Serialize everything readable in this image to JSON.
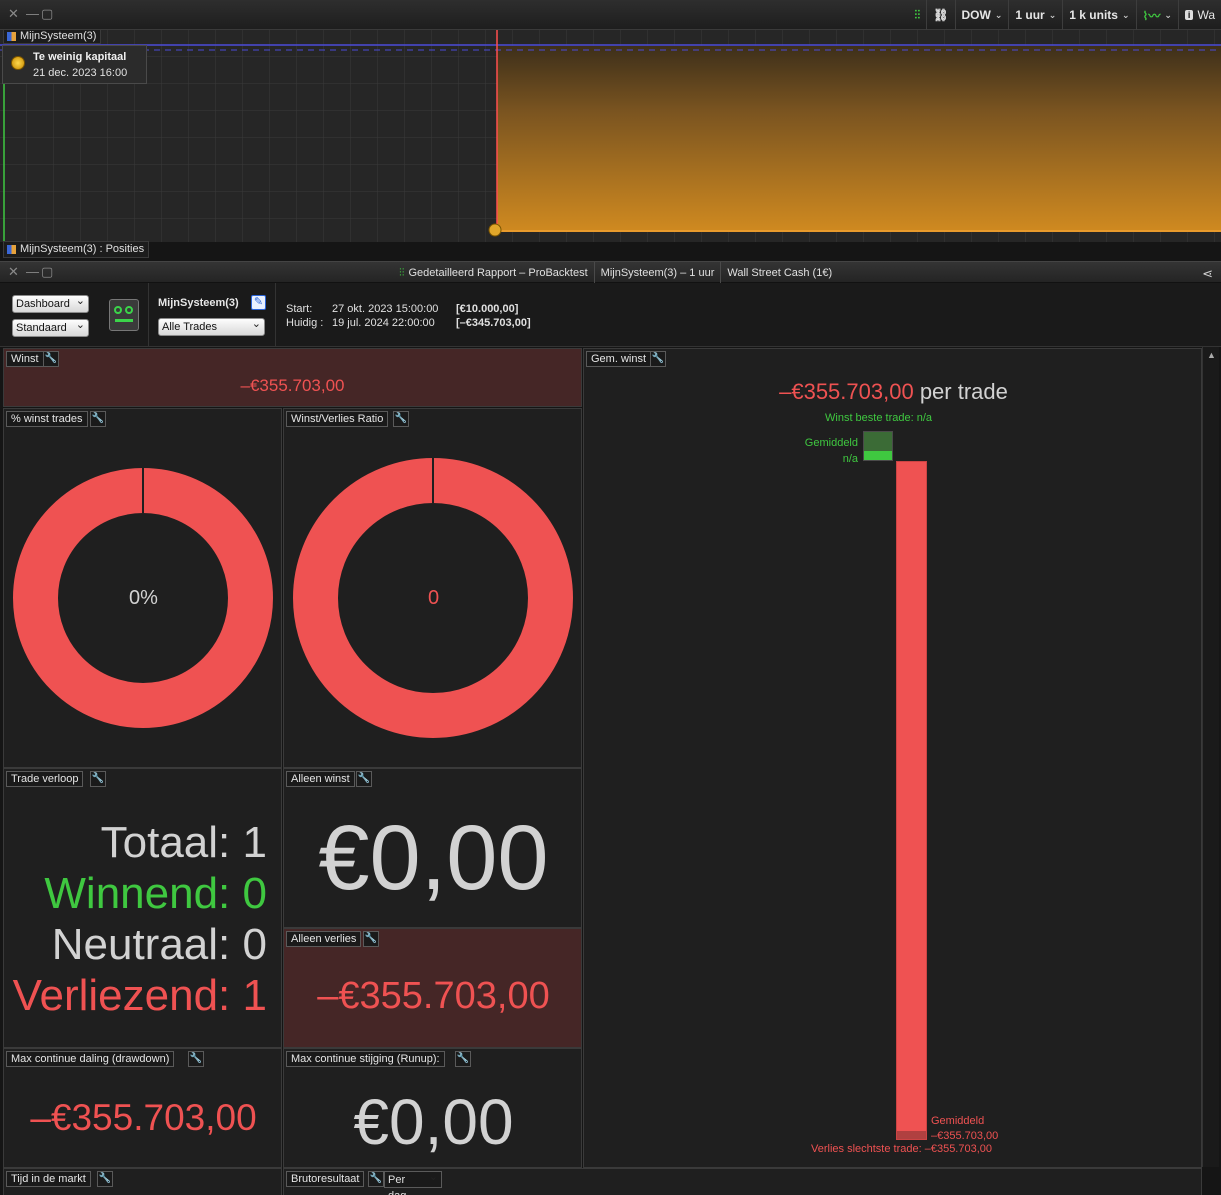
{
  "toolbar": {
    "instrument": "DOW",
    "timeframe": "1 uur",
    "units": "1 k units",
    "cut_label": "Wa"
  },
  "chart": {
    "system_tag": "MijnSysteem(3)",
    "tooltip_title": "Te weinig kapitaal",
    "tooltip_date": "21 dec. 2023 16:00",
    "positions_tag": "MijnSysteem(3) : Posities"
  },
  "report": {
    "title_1": "Gedetailleerd Rapport – ProBacktest",
    "title_2": "MijnSysteem(3) – 1 uur",
    "title_3": "Wall Street Cash (1€)"
  },
  "controls": {
    "view_select": "Dashboard",
    "layout_select": "Standaard",
    "system_name": "MijnSysteem(3)",
    "trades_select": "Alle Trades",
    "start_label": "Start:",
    "start_date": "27 okt. 2023 15:00:00",
    "start_amount": "[€10.000,00]",
    "current_label": "Huidig :",
    "current_date": "19 jul. 2024 22:00:00",
    "current_amount": "[–€345.703,00]"
  },
  "panels": {
    "winst": {
      "title": "Winst",
      "value": "–€355.703,00"
    },
    "pct_winst": {
      "title": "% winst trades",
      "value": "0%",
      "win_fraction": 0
    },
    "ratio": {
      "title": "Winst/Verlies Ratio",
      "value": "0",
      "win_fraction": 0
    },
    "trade_verloop": {
      "title": "Trade verloop",
      "totaal_label": "Totaal:",
      "totaal": "1",
      "winnend_label": "Winnend:",
      "winnend": "0",
      "neutraal_label": "Neutraal:",
      "neutraal": "0",
      "verliezend_label": "Verliezend:",
      "verliezend": "1"
    },
    "alleen_winst": {
      "title": "Alleen winst",
      "value": "€0,00"
    },
    "alleen_verlies": {
      "title": "Alleen verlies",
      "value": "–€355.703,00"
    },
    "drawdown": {
      "title": "Max continue daling (drawdown)",
      "value": "–€355.703,00"
    },
    "runup": {
      "title": "Max continue stijging (Runup):",
      "value": "€0,00"
    },
    "tijd": {
      "title": "Tijd in de markt"
    },
    "bruto": {
      "title": "Brutoresultaat",
      "period_select": "Per dag"
    },
    "gem_winst": {
      "title": "Gem. winst",
      "headline_value": "–€355.703,00",
      "headline_suffix": "per trade",
      "best_trade": "Winst beste trade: n/a",
      "avg_win_label": "Gemiddeld",
      "avg_win_value": "n/a",
      "avg_loss_label": "Gemiddeld",
      "avg_loss_value": "–€355.703,00",
      "worst_trade": "Verlies slechtste trade: –€355.703,00"
    }
  },
  "colors": {
    "loss": "#ef5252",
    "win": "#3fc840",
    "equity_fill": "#c8821e"
  }
}
